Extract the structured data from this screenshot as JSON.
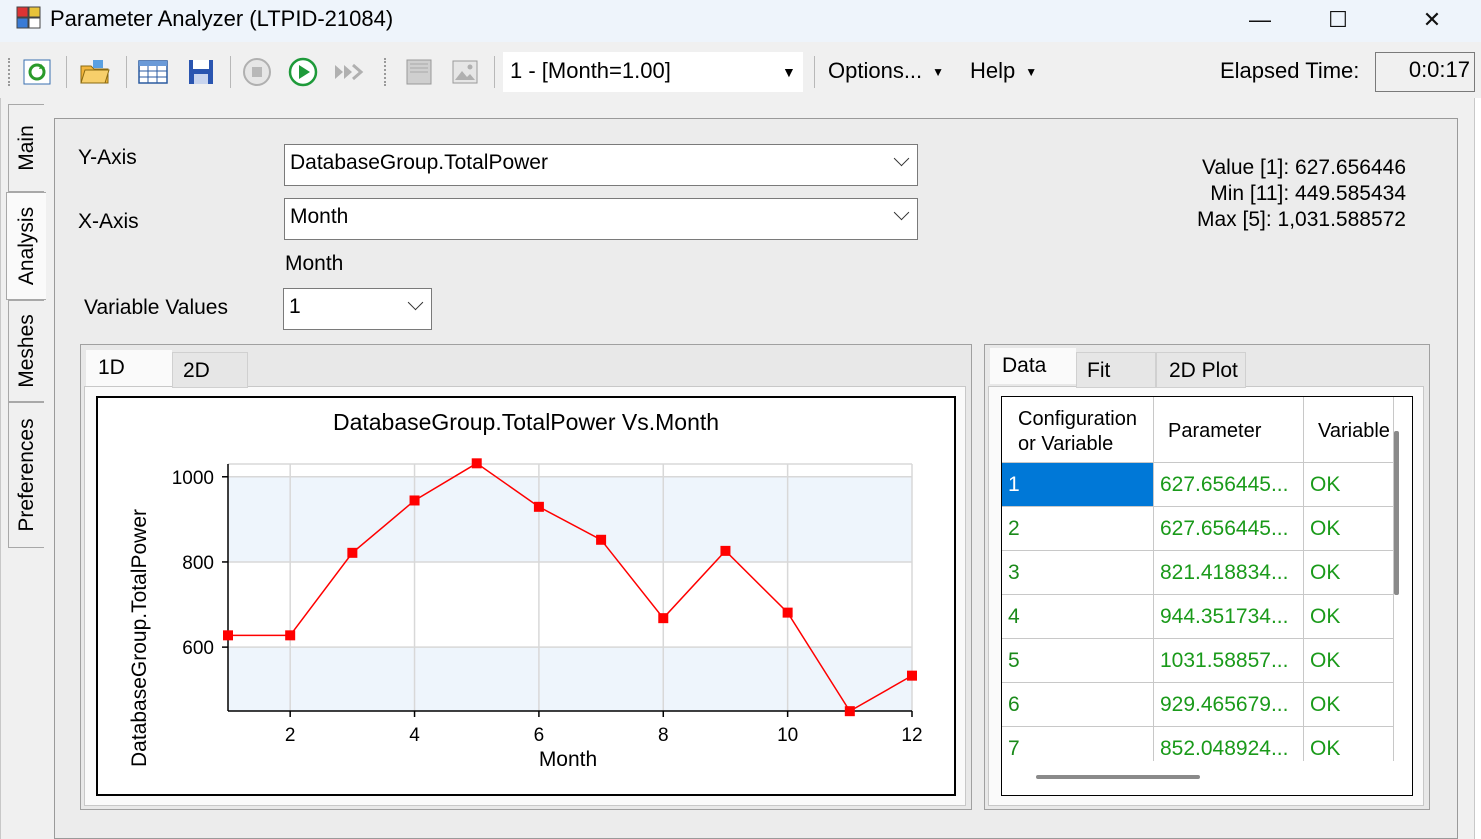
{
  "window": {
    "title": "Parameter Analyzer (LTPID-21084)",
    "minimize_glyph": "—",
    "maximize_glyph": "☐",
    "close_glyph": "✕"
  },
  "toolbar": {
    "run_selector": "1 - [Month=1.00]",
    "menus": [
      "Options...",
      "Help"
    ],
    "elapsed_label": "Elapsed Time:",
    "elapsed_value": "0:0:17"
  },
  "side_tabs": [
    "Main",
    "Analysis",
    "Meshes",
    "Preferences"
  ],
  "analysis": {
    "y_axis_label": "Y-Axis",
    "y_axis_value": "DatabaseGroup.TotalPower",
    "x_axis_label": "X-Axis",
    "x_axis_value": "Month",
    "variable_name": "Month",
    "variable_values_label": "Variable Values",
    "variable_values_value": "1",
    "value_stat": "Value [1]: 627.656446",
    "min_stat": "Min [11]: 449.585434",
    "max_stat": "Max [5]: 1,031.588572"
  },
  "plot_tabs": [
    "1D",
    "2D"
  ],
  "data_tabs": [
    "Data",
    "Fit",
    "2D Plot"
  ],
  "table": {
    "columns": [
      "Configuration or Variable",
      "Parameter",
      "Variable"
    ],
    "rows": [
      [
        "1",
        "627.656445...",
        "OK"
      ],
      [
        "2",
        "627.656445...",
        "OK"
      ],
      [
        "3",
        "821.418834...",
        "OK"
      ],
      [
        "4",
        "944.351734...",
        "OK"
      ],
      [
        "5",
        "1031.58857...",
        "OK"
      ],
      [
        "6",
        "929.465679...",
        "OK"
      ],
      [
        "7",
        "852.048924...",
        "OK"
      ]
    ]
  },
  "chart_data": {
    "type": "line",
    "title": "DatabaseGroup.TotalPower Vs.Month",
    "xlabel": "Month",
    "ylabel": "DatabaseGroup.TotalPower",
    "x": [
      1,
      2,
      3,
      4,
      5,
      6,
      7,
      8,
      9,
      10,
      11,
      12
    ],
    "y": [
      627.66,
      627.66,
      821.42,
      944.35,
      1031.59,
      929.47,
      852.05,
      668,
      826,
      681,
      449.59,
      533
    ],
    "xlim": [
      1,
      12
    ],
    "ylim": [
      450,
      1030
    ],
    "xticks": [
      2,
      4,
      6,
      8,
      10,
      12
    ],
    "yticks": [
      600,
      800,
      1000
    ],
    "grid": true,
    "series_color": "#ff0000",
    "band_color": "#eef5fc"
  }
}
